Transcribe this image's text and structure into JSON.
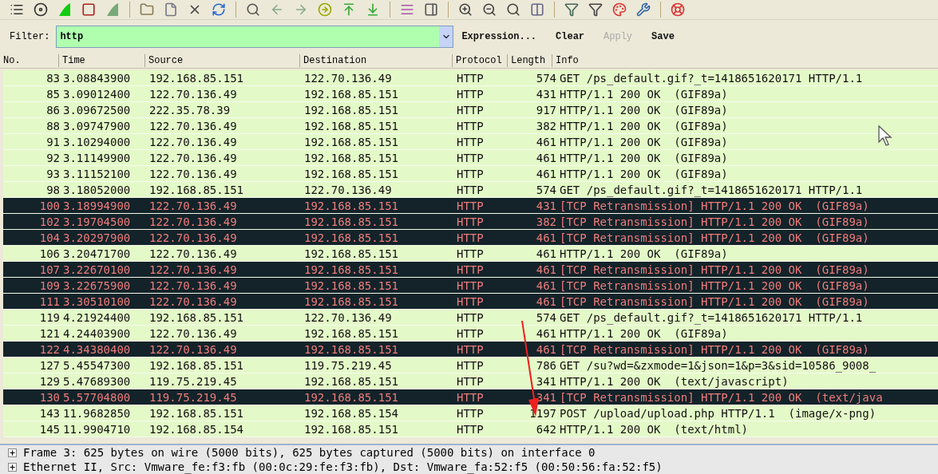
{
  "filter": {
    "label": "Filter:",
    "value": "http"
  },
  "filter_buttons": [
    {
      "label": "Expression...",
      "disabled": false
    },
    {
      "label": "Clear",
      "disabled": false
    },
    {
      "label": "Apply",
      "disabled": true
    },
    {
      "label": "Save",
      "disabled": false
    }
  ],
  "table": {
    "columns": [
      "No.",
      "Time",
      "Source",
      "Destination",
      "Protocol",
      "Length",
      "Info"
    ],
    "rows": [
      {
        "kind": "normal",
        "cells": [
          "83",
          "3.08843900",
          "192.168.85.151",
          "122.70.136.49",
          "HTTP",
          "574",
          "GET /ps_default.gif?_t=1418651620171 HTTP/1.1"
        ]
      },
      {
        "kind": "normal",
        "cells": [
          "85",
          "3.09012400",
          "122.70.136.49",
          "192.168.85.151",
          "HTTP",
          "431",
          "HTTP/1.1 200 OK  (GIF89a)"
        ]
      },
      {
        "kind": "normal",
        "cells": [
          "86",
          "3.09672500",
          "222.35.78.39",
          "192.168.85.151",
          "HTTP",
          "917",
          "HTTP/1.1 200 OK  (GIF89a)"
        ]
      },
      {
        "kind": "normal",
        "cells": [
          "88",
          "3.09747900",
          "122.70.136.49",
          "192.168.85.151",
          "HTTP",
          "382",
          "HTTP/1.1 200 OK  (GIF89a)"
        ]
      },
      {
        "kind": "normal",
        "cells": [
          "91",
          "3.10294000",
          "122.70.136.49",
          "192.168.85.151",
          "HTTP",
          "461",
          "HTTP/1.1 200 OK  (GIF89a)"
        ]
      },
      {
        "kind": "normal",
        "cells": [
          "92",
          "3.11149900",
          "122.70.136.49",
          "192.168.85.151",
          "HTTP",
          "461",
          "HTTP/1.1 200 OK  (GIF89a)"
        ]
      },
      {
        "kind": "normal",
        "cells": [
          "93",
          "3.11152100",
          "122.70.136.49",
          "192.168.85.151",
          "HTTP",
          "461",
          "HTTP/1.1 200 OK  (GIF89a)"
        ]
      },
      {
        "kind": "normal",
        "cells": [
          "98",
          "3.18052000",
          "192.168.85.151",
          "122.70.136.49",
          "HTTP",
          "574",
          "GET /ps_default.gif?_t=1418651620171 HTTP/1.1"
        ]
      },
      {
        "kind": "retransmission",
        "cells": [
          "100",
          "3.18994900",
          "122.70.136.49",
          "192.168.85.151",
          "HTTP",
          "431",
          "[TCP Retransmission] HTTP/1.1 200 OK  (GIF89a)"
        ]
      },
      {
        "kind": "retransmission",
        "cells": [
          "102",
          "3.19704500",
          "122.70.136.49",
          "192.168.85.151",
          "HTTP",
          "382",
          "[TCP Retransmission] HTTP/1.1 200 OK  (GIF89a)"
        ]
      },
      {
        "kind": "retransmission",
        "cells": [
          "104",
          "3.20297900",
          "122.70.136.49",
          "192.168.85.151",
          "HTTP",
          "461",
          "[TCP Retransmission] HTTP/1.1 200 OK  (GIF89a)"
        ]
      },
      {
        "kind": "normal",
        "cells": [
          "106",
          "3.20471700",
          "122.70.136.49",
          "192.168.85.151",
          "HTTP",
          "461",
          "HTTP/1.1 200 OK  (GIF89a)"
        ]
      },
      {
        "kind": "retransmission",
        "cells": [
          "107",
          "3.22670100",
          "122.70.136.49",
          "192.168.85.151",
          "HTTP",
          "461",
          "[TCP Retransmission] HTTP/1.1 200 OK  (GIF89a)"
        ]
      },
      {
        "kind": "retransmission",
        "cells": [
          "109",
          "3.22675900",
          "122.70.136.49",
          "192.168.85.151",
          "HTTP",
          "461",
          "[TCP Retransmission] HTTP/1.1 200 OK  (GIF89a)"
        ]
      },
      {
        "kind": "retransmission",
        "cells": [
          "111",
          "3.30510100",
          "122.70.136.49",
          "192.168.85.151",
          "HTTP",
          "461",
          "[TCP Retransmission] HTTP/1.1 200 OK  (GIF89a)"
        ]
      },
      {
        "kind": "normal",
        "cells": [
          "119",
          "4.21924400",
          "192.168.85.151",
          "122.70.136.49",
          "HTTP",
          "574",
          "GET /ps_default.gif?_t=1418651620171 HTTP/1.1"
        ]
      },
      {
        "kind": "normal",
        "cells": [
          "121",
          "4.24403900",
          "122.70.136.49",
          "192.168.85.151",
          "HTTP",
          "461",
          "HTTP/1.1 200 OK  (GIF89a)"
        ]
      },
      {
        "kind": "retransmission",
        "cells": [
          "122",
          "4.34380400",
          "122.70.136.49",
          "192.168.85.151",
          "HTTP",
          "461",
          "[TCP Retransmission] HTTP/1.1 200 OK  (GIF89a)"
        ]
      },
      {
        "kind": "normal",
        "cells": [
          "127",
          "5.45547300",
          "192.168.85.151",
          "119.75.219.45",
          "HTTP",
          "786",
          "GET /su?wd=&zxmode=1&json=1&p=3&sid=10586_9008_"
        ]
      },
      {
        "kind": "normal",
        "cells": [
          "129",
          "5.47689300",
          "119.75.219.45",
          "192.168.85.151",
          "HTTP",
          "341",
          "HTTP/1.1 200 OK  (text/javascript)"
        ]
      },
      {
        "kind": "retransmission",
        "cells": [
          "130",
          "5.57704800",
          "119.75.219.45",
          "192.168.85.151",
          "HTTP",
          "341",
          "[TCP Retransmission] HTTP/1.1 200 OK  (text/java"
        ]
      },
      {
        "kind": "normal",
        "cells": [
          "143",
          "11.9682850",
          "192.168.85.151",
          "192.168.85.154",
          "HTTP",
          "1197",
          "POST /upload/upload.php HTTP/1.1  (image/x-png)"
        ]
      },
      {
        "kind": "normal",
        "cells": [
          "145",
          "11.9904710",
          "192.168.85.154",
          "192.168.85.151",
          "HTTP",
          "642",
          "HTTP/1.1 200 OK  (text/html)"
        ]
      }
    ]
  },
  "details": [
    {
      "text": "Frame 3: 625 bytes on wire (5000 bits), 625 bytes captured (5000 bits) on interface 0",
      "expanded": false
    },
    {
      "text": "Ethernet II, Src: Vmware_fe:f3:fb (00:0c:29:fe:f3:fb), Dst: Vmware_fa:52:f5 (00:50:56:fa:52:f5)",
      "expanded": false
    }
  ]
}
